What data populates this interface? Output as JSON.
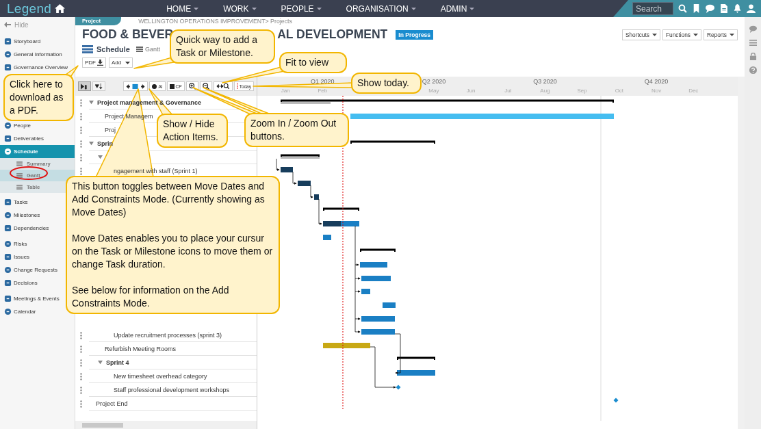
{
  "top_bar": {
    "logo": "Legend",
    "nav": [
      {
        "label": "HOME"
      },
      {
        "label": "WORK"
      },
      {
        "label": "PEOPLE"
      },
      {
        "label": "ORGANISATION"
      },
      {
        "label": "ADMIN"
      }
    ],
    "search": {
      "placeholder": "Search"
    }
  },
  "sidebar": {
    "hide": "Hide",
    "groups": [
      {
        "items": [
          {
            "label": "Storyboard",
            "selected": false
          },
          {
            "label": "General Information",
            "selected": false
          },
          {
            "label": "Governance Overview",
            "selected": false
          }
        ]
      },
      {
        "items": [
          {
            "label": "People",
            "selected": false
          },
          {
            "label": "Deliverables",
            "selected": false
          },
          {
            "label": "Schedule",
            "selected": true,
            "children": [
              {
                "label": "Summary",
                "selected": false
              },
              {
                "label": "Gantt",
                "selected": true
              },
              {
                "label": "Table",
                "selected": false
              }
            ]
          }
        ]
      },
      {
        "items": [
          {
            "label": "Tasks",
            "selected": false
          },
          {
            "label": "Milestones",
            "selected": false
          },
          {
            "label": "Dependencies",
            "selected": false
          }
        ]
      },
      {
        "items": [
          {
            "label": "Risks",
            "selected": false
          },
          {
            "label": "Issues",
            "selected": false
          },
          {
            "label": "Change Requests",
            "selected": false
          },
          {
            "label": "Decisions",
            "selected": false
          }
        ]
      },
      {
        "items": [
          {
            "label": "Meetings & Events",
            "selected": false
          },
          {
            "label": "Calendar",
            "selected": false
          }
        ]
      }
    ]
  },
  "header": {
    "tab": "Project",
    "breadcrumb": "WELLINGTON OPERATIONS IMPROVEMENT> Projects",
    "title_parts": [
      "FOOD & BEVER",
      "AL DEVELOPMENT"
    ],
    "status": "In Progress",
    "section": "Schedule",
    "view": "Gantt",
    "buttons": [
      {
        "label": "PDF",
        "kind": "download"
      },
      {
        "label": "Add",
        "kind": "dropdown"
      }
    ],
    "menus": [
      "Shortcuts",
      "Functions",
      "Reports"
    ]
  },
  "toolbar": {
    "view_modes": [
      {
        "selected": true
      },
      {
        "selected": false
      }
    ],
    "add_constraints_mode": false,
    "action_items": "AI",
    "critical_path": "CP",
    "today": "Today"
  },
  "timeline": {
    "quarters": [
      {
        "label": "Q1 2020",
        "months": [
          "Jan",
          "Feb"
        ]
      },
      {
        "label": "Q2 2020",
        "months": [
          "May",
          "Jun"
        ]
      },
      {
        "label": "Q3 2020",
        "months": [
          "Jul",
          "Aug",
          "Sep"
        ]
      },
      {
        "label": "Q4 2020",
        "months": [
          "Oct",
          "Nov",
          "Dec"
        ]
      }
    ]
  },
  "tasks": [
    {
      "label": "Project management & Governance",
      "expanded": true,
      "children": [
        {
          "label": "Project Managem"
        },
        {
          "label": "Proj"
        }
      ]
    },
    {
      "label": "Sprin",
      "expanded": true,
      "children": [
        {
          "expanded": true,
          "children": [
            {
              "label": "ngagement with staff (Sprint 1)"
            }
          ]
        },
        {
          "children": [
            {
              "label": "Update recruitment processes (sprint 3)"
            }
          ]
        },
        {
          "label": "Refurbish Meeting Rooms"
        },
        {
          "label": "Sprint 4",
          "expanded": true,
          "children": [
            {
              "label": "New timesheet overhead category"
            },
            {
              "label": "Staff professional development workshops"
            }
          ]
        }
      ]
    },
    {
      "label": "Project End"
    }
  ],
  "callouts": [
    {
      "text": "Quick way to add a Task or Milestone."
    },
    {
      "text": "Click here to download as a PDF."
    },
    {
      "text": "Fit to view"
    },
    {
      "text": "Show today."
    },
    {
      "text": "Show / Hide Action Items."
    },
    {
      "text": "Zoom In / Zoom Out buttons."
    },
    {
      "paragraphs": [
        "This button toggles between Move Dates and Add Constraints Mode. (Currently showing as Move Dates)",
        "Move Dates enables you to place your cursur on the Task or Milestone icons to move them or change Task duration.",
        "See below for information on the Add Constraints Mode."
      ]
    }
  ]
}
